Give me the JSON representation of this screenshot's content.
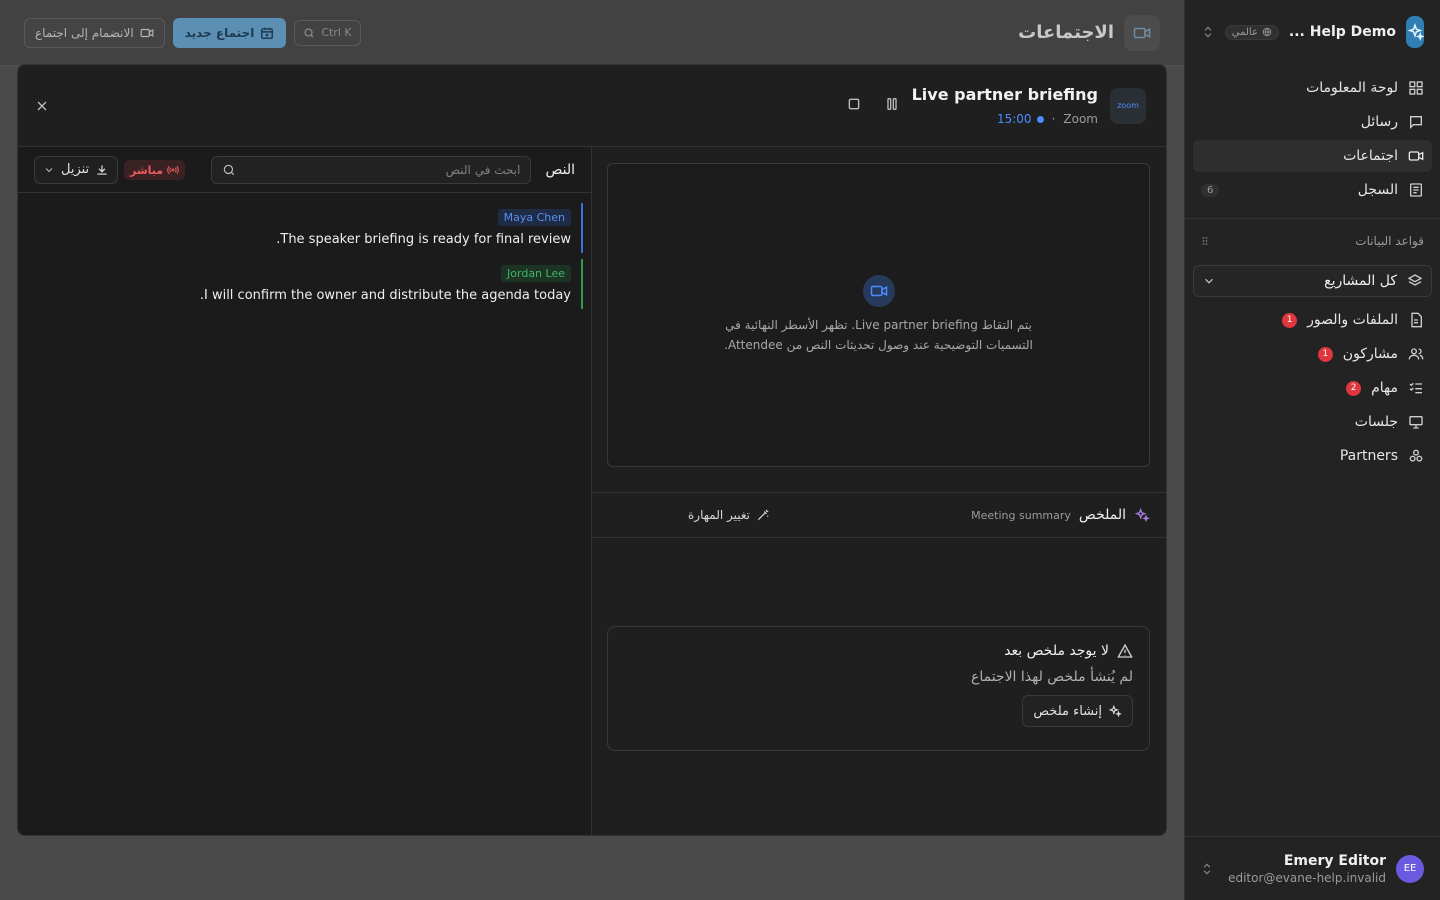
{
  "workspace": {
    "name": "Help Demo ...",
    "badge": "عالمي"
  },
  "nav": {
    "items": [
      {
        "label": "لوحة المعلومات",
        "icon": "dashboard-icon"
      },
      {
        "label": "رسائل",
        "icon": "message-icon"
      },
      {
        "label": "اجتماعات",
        "icon": "video-icon"
      },
      {
        "label": "السجل",
        "icon": "log-icon",
        "count": "6"
      }
    ],
    "active": "اجتماعات"
  },
  "databases": {
    "title": "قواعد البيانات",
    "project_select": "كل المشاريع",
    "items": [
      {
        "label": "الملفات والصور",
        "badge": "1"
      },
      {
        "label": "مشاركون",
        "badge": "1"
      },
      {
        "label": "مهام",
        "badge": "2"
      },
      {
        "label": "جلسات"
      },
      {
        "label": "Partners"
      }
    ]
  },
  "user": {
    "initials": "EE",
    "name": "Emery Editor",
    "email": "editor@evane-help.invalid"
  },
  "topbar": {
    "title": "الاجتماعات",
    "new_meeting": "اجتماع جديد",
    "join_meeting": "الانضمام إلى اجتماع",
    "shortcut": "Ctrl K"
  },
  "meeting": {
    "logo_text": "zoom",
    "title": "Live partner briefing",
    "platform": "Zoom",
    "separator": "·",
    "time": "15:00"
  },
  "video": {
    "message": "يتم التقاط Live partner briefing. تظهر الأسطر النهائية في التسميات التوضيحية عند وصول تحديثات النص من Attendee."
  },
  "summary": {
    "title": "الملخص",
    "subtitle": "Meeting summary",
    "change_skill": "تغيير المهارة",
    "empty_title": "لا يوجد ملخص بعد",
    "empty_desc": "لم يُنشأ ملخص لهذا الاجتماع",
    "generate": "إنشاء ملخص"
  },
  "transcript": {
    "title": "النص",
    "search_placeholder": "ابحث في النص",
    "live": "مباشر",
    "download": "تنزيل",
    "utterances": [
      {
        "speaker": "Maya Chen",
        "text": "The speaker briefing is ready for final review.",
        "color": "#3d6fd8"
      },
      {
        "speaker": "Jordan Lee",
        "text": "I will confirm the owner and distribute the agenda today.",
        "color": "#2d9b4d"
      }
    ]
  },
  "colors": {
    "accent": "#2f7fb5",
    "live": "#ef5a5a",
    "time": "#4a8cff"
  }
}
